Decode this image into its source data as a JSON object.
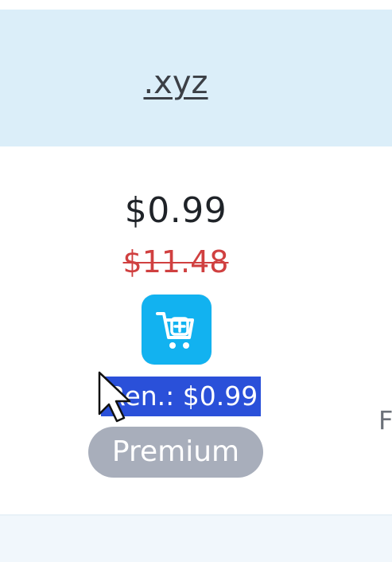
{
  "header": {
    "tld": ".xyz"
  },
  "pricing": {
    "price": "$0.99",
    "old_price": "$11.48",
    "renewal_text": "Ren.: $0.99",
    "badge": "Premium"
  },
  "cart": {
    "icon": "add-to-cart-icon"
  },
  "side_column": {
    "peek_text": "F"
  },
  "colors": {
    "header_bg": "#dbeef9",
    "cart_button": "#12b2f0",
    "old_price": "#d04040",
    "selection": "#2a50d9",
    "badge_bg": "#a8aebb"
  }
}
